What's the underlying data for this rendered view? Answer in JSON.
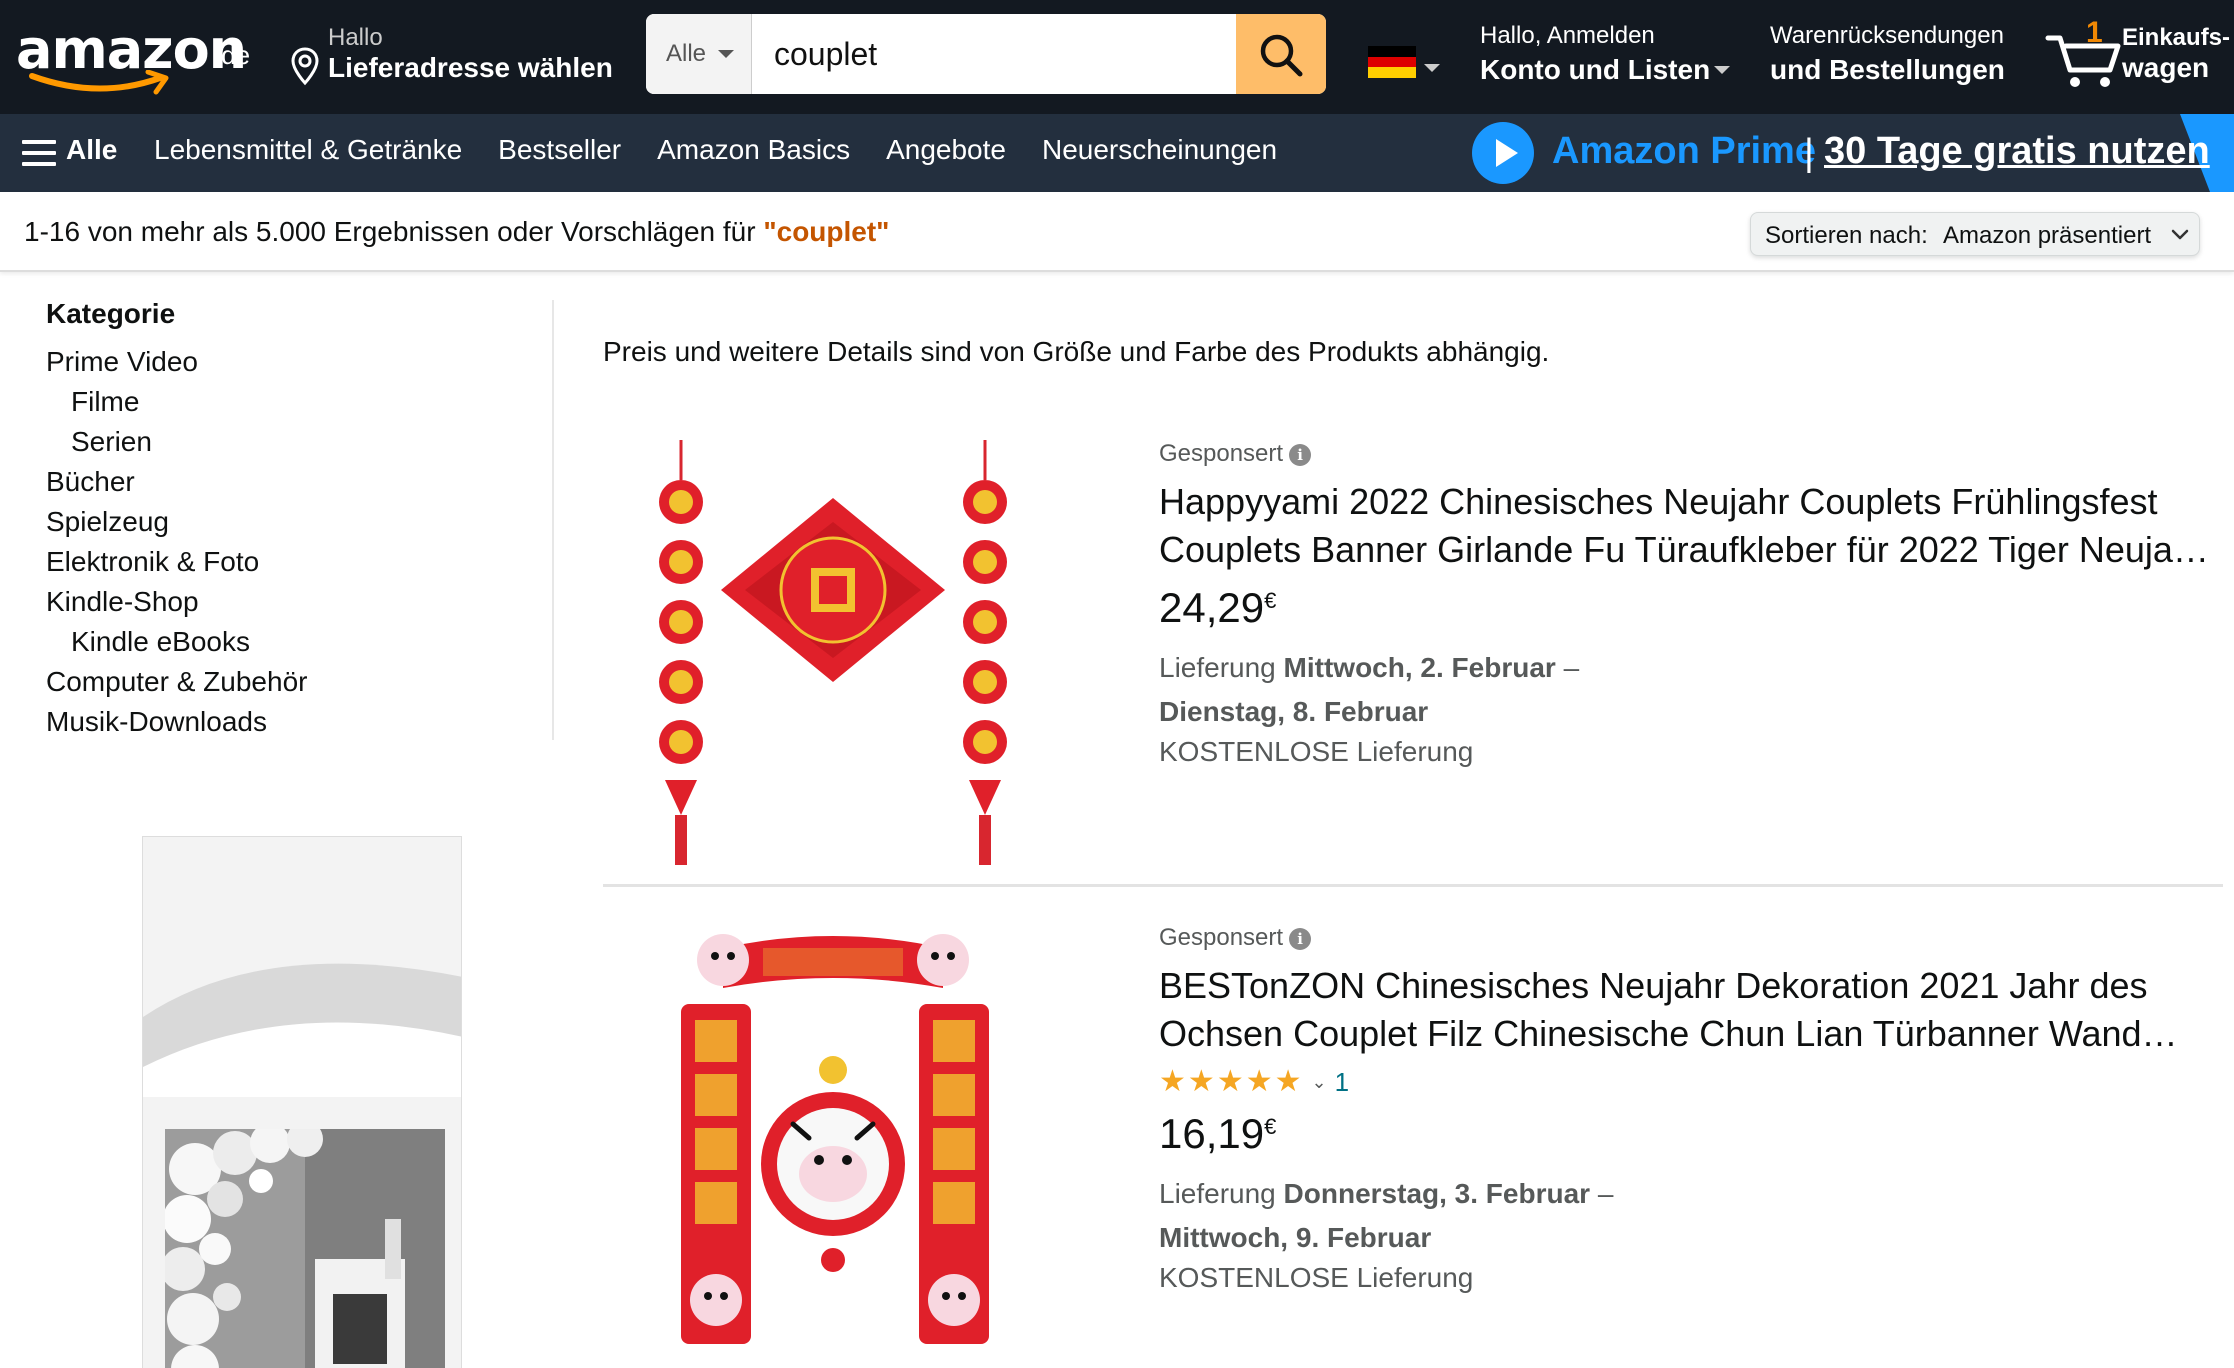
{
  "header": {
    "logo_text": "amazon",
    "logo_tld": ".de",
    "deliver_line1": "Hallo",
    "deliver_line2": "Lieferadresse wählen",
    "search_category": "Alle",
    "search_value": "couplet",
    "account_line1": "Hallo, Anmelden",
    "account_line2": "Konto und Listen",
    "orders_line1": "Warenrücksendungen",
    "orders_line2": "und Bestellungen",
    "cart_count": "1",
    "cart_line1": "Einkaufs-",
    "cart_line2": "wagen"
  },
  "subnav": {
    "all_label": "Alle",
    "links": [
      "Lebensmittel & Getränke",
      "Bestseller",
      "Amazon Basics",
      "Angebote",
      "Neuerscheinungen"
    ],
    "prime_name": "Amazon Prime",
    "prime_sep": "|",
    "prime_cta": "30 Tage gratis nutzen"
  },
  "results_bar": {
    "summary": "1-16 von mehr als 5.000 Ergebnissen oder Vorschlägen für ",
    "query": "\"couplet\"",
    "sort_label": "Sortieren nach:",
    "sort_value": "Amazon präsentiert"
  },
  "sidebar": {
    "heading": "Kategorie",
    "items": [
      {
        "label": "Prime Video",
        "sub": false
      },
      {
        "label": "Filme",
        "sub": true
      },
      {
        "label": "Serien",
        "sub": true
      },
      {
        "label": "Bücher",
        "sub": false
      },
      {
        "label": "Spielzeug",
        "sub": false
      },
      {
        "label": "Elektronik & Foto",
        "sub": false
      },
      {
        "label": "Kindle-Shop",
        "sub": false
      },
      {
        "label": "Kindle eBooks",
        "sub": true
      },
      {
        "label": "Computer & Zubehör",
        "sub": false
      },
      {
        "label": "Musik-Downloads",
        "sub": false
      }
    ]
  },
  "main": {
    "note": "Preis und weitere Details sind von Größe und Farbe des Produkts abhängig.",
    "results": [
      {
        "sponsored": "Gesponsert",
        "title": "Happyyami 2022 Chinesisches Neujahr Couplets Frühlingsfest Couplets Banner Girlande Fu Türaufkleber für 2022 Tiger Neuja…",
        "price_whole": "24,29",
        "price_currency": "€",
        "delivery_prefix": "Lieferung ",
        "delivery_date1": "Mittwoch, 2. Februar",
        "delivery_dash": " –",
        "delivery_date2": "Dienstag, 8. Februar",
        "free": "KOSTENLOSE Lieferung"
      },
      {
        "sponsored": "Gesponsert",
        "title": "BESTonZON Chinesisches Neujahr Dekoration 2021 Jahr des Ochsen Couplet Filz Chinesische Chun Lian Türbanner Wand…",
        "rating": 5,
        "rating_count": "1",
        "price_whole": "16,19",
        "price_currency": "€",
        "delivery_prefix": "Lieferung ",
        "delivery_date1": "Donnerstag, 3. Februar",
        "delivery_dash": " –",
        "delivery_date2": "Mittwoch, 9. Februar",
        "free": "KOSTENLOSE Lieferung"
      }
    ]
  },
  "colors": {
    "nav_dark": "#131921",
    "nav_sub": "#232f3e",
    "search_button": "#febd69",
    "query_orange": "#c45500",
    "prime_blue": "#1a98ff",
    "star": "#f5a623",
    "link_teal": "#007185",
    "couplet_red": "#e0202a",
    "gold": "#f2c230"
  },
  "icons": {
    "location": "location-pin-icon",
    "search": "magnifier-icon",
    "cart": "cart-icon",
    "menu": "hamburger-icon",
    "play": "play-icon",
    "info": "info-icon",
    "star": "star-icon"
  }
}
